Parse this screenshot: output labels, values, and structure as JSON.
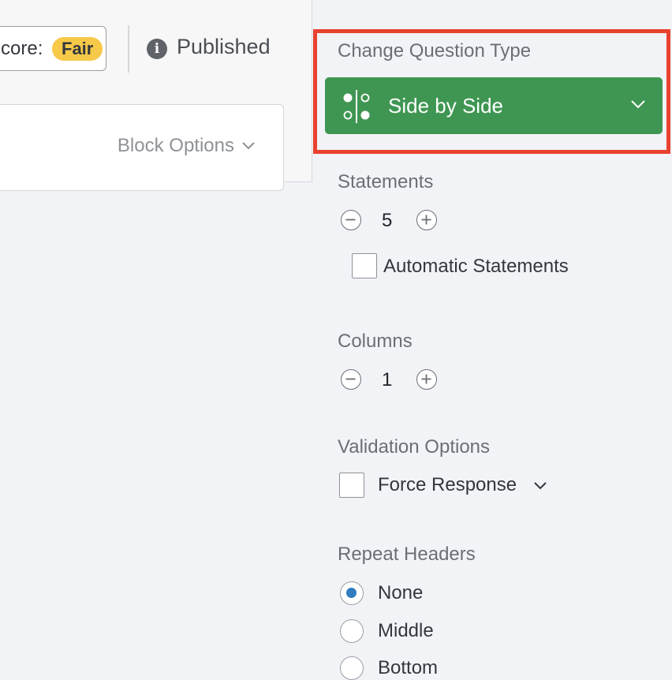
{
  "canvas": {
    "score_label": "core:",
    "score_badge": "Fair",
    "info_icon": "info-icon",
    "status": "Published",
    "block_options": "Block Options"
  },
  "panel": {
    "question_type": {
      "title": "Change Question Type",
      "selected": "Side by Side",
      "icon": "side-by-side-icon",
      "color": "#3f9652"
    },
    "statements": {
      "title": "Statements",
      "value": "5",
      "auto_label": "Automatic Statements"
    },
    "columns": {
      "title": "Columns",
      "value": "1"
    },
    "validation": {
      "title": "Validation Options",
      "force_response": "Force Response"
    },
    "repeat_headers": {
      "title": "Repeat Headers",
      "options": [
        "None",
        "Middle",
        "Bottom"
      ],
      "selected": "None"
    }
  },
  "colors": {
    "highlight": "#e8412d",
    "radio_selected": "#2f7dc0",
    "badge": "#f7c948"
  }
}
